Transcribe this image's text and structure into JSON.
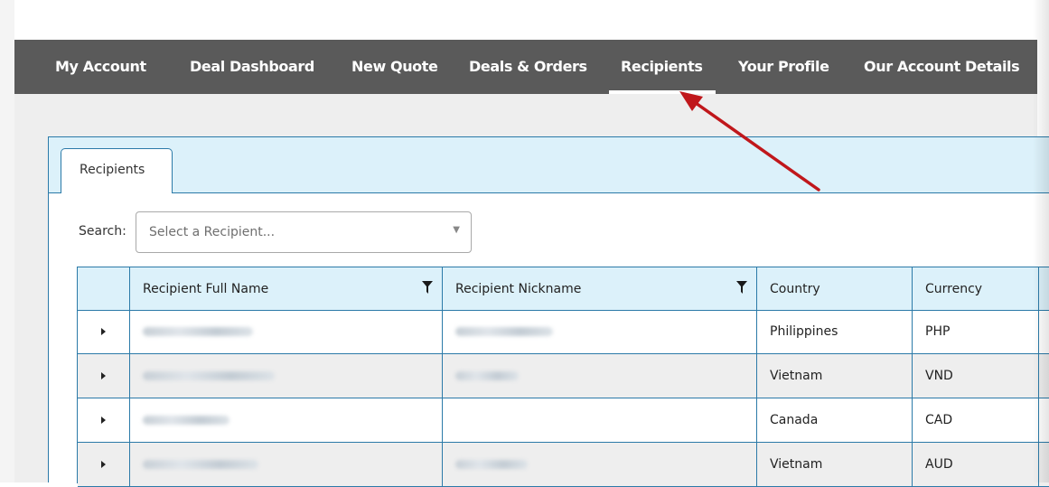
{
  "nav": {
    "items": [
      {
        "label": "My Account",
        "active": false
      },
      {
        "label": "Deal Dashboard",
        "active": false
      },
      {
        "label": "New Quote",
        "active": false
      },
      {
        "label": "Deals & Orders",
        "active": false
      },
      {
        "label": "Recipients",
        "active": true
      },
      {
        "label": "Your Profile",
        "active": false
      },
      {
        "label": "Our Account Details",
        "active": false
      }
    ]
  },
  "panel": {
    "tab_label": "Recipients",
    "search": {
      "label": "Search:",
      "placeholder": "Select a Recipient..."
    },
    "table": {
      "columns": [
        "Recipient Full Name",
        "Recipient Nickname",
        "Country",
        "Currency"
      ],
      "rows": [
        {
          "full_name": "[redacted]",
          "nickname": "[redacted]",
          "country": "Philippines",
          "currency": "PHP"
        },
        {
          "full_name": "[redacted]",
          "nickname": "[redacted]",
          "country": "Vietnam",
          "currency": "VND"
        },
        {
          "full_name": "[redacted]",
          "nickname": "",
          "country": "Canada",
          "currency": "CAD"
        },
        {
          "full_name": "[redacted]",
          "nickname": "[redacted]",
          "country": "Vietnam",
          "currency": "AUD"
        }
      ]
    }
  },
  "colors": {
    "navbar": "#5a5a5a",
    "accent_border": "#2b7aa8",
    "header_fill": "#dcf1fa",
    "arrow": "#c0171b"
  },
  "icons": {
    "filter": "filter-icon",
    "expand": "expand-row-icon",
    "dropdown": "chevron-down-icon"
  }
}
